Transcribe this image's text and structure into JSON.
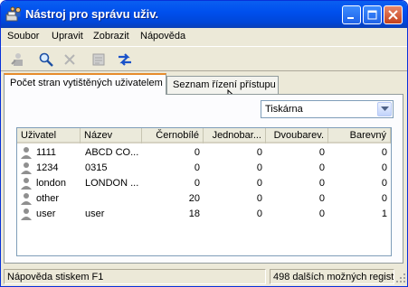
{
  "window": {
    "title": "Nástroj pro správu uživ.",
    "icon": "printer-users-icon"
  },
  "menu": [
    "Soubor",
    "Upravit",
    "Zobrazit",
    "Nápověda"
  ],
  "toolbar": {
    "icons": [
      "add-user-icon",
      "search-icon",
      "delete-icon",
      "properties-icon",
      "refresh-icon"
    ]
  },
  "tabs": [
    {
      "label": "Počet stran vytištěných uživatelem",
      "active": true
    },
    {
      "label": "Seznam řízení přístupu",
      "active": false
    }
  ],
  "combo": {
    "value": "Tiskárna"
  },
  "table": {
    "columns": [
      "Uživatel",
      "Název",
      "Černobílé",
      "Jednobar...",
      "Dvoubarev.",
      "Barevný"
    ],
    "rows": [
      [
        "1111",
        "ABCD CO...",
        "0",
        "0",
        "0",
        "0"
      ],
      [
        "1234",
        "0315",
        "0",
        "0",
        "0",
        "0"
      ],
      [
        "london",
        "LONDON ...",
        "0",
        "0",
        "0",
        "0"
      ],
      [
        "other",
        "",
        "20",
        "0",
        "0",
        "0"
      ],
      [
        "user",
        "user",
        "18",
        "0",
        "0",
        "1"
      ]
    ]
  },
  "status": {
    "help": "Nápověda stiskem F1",
    "remaining": "498 dalších možných registr"
  }
}
